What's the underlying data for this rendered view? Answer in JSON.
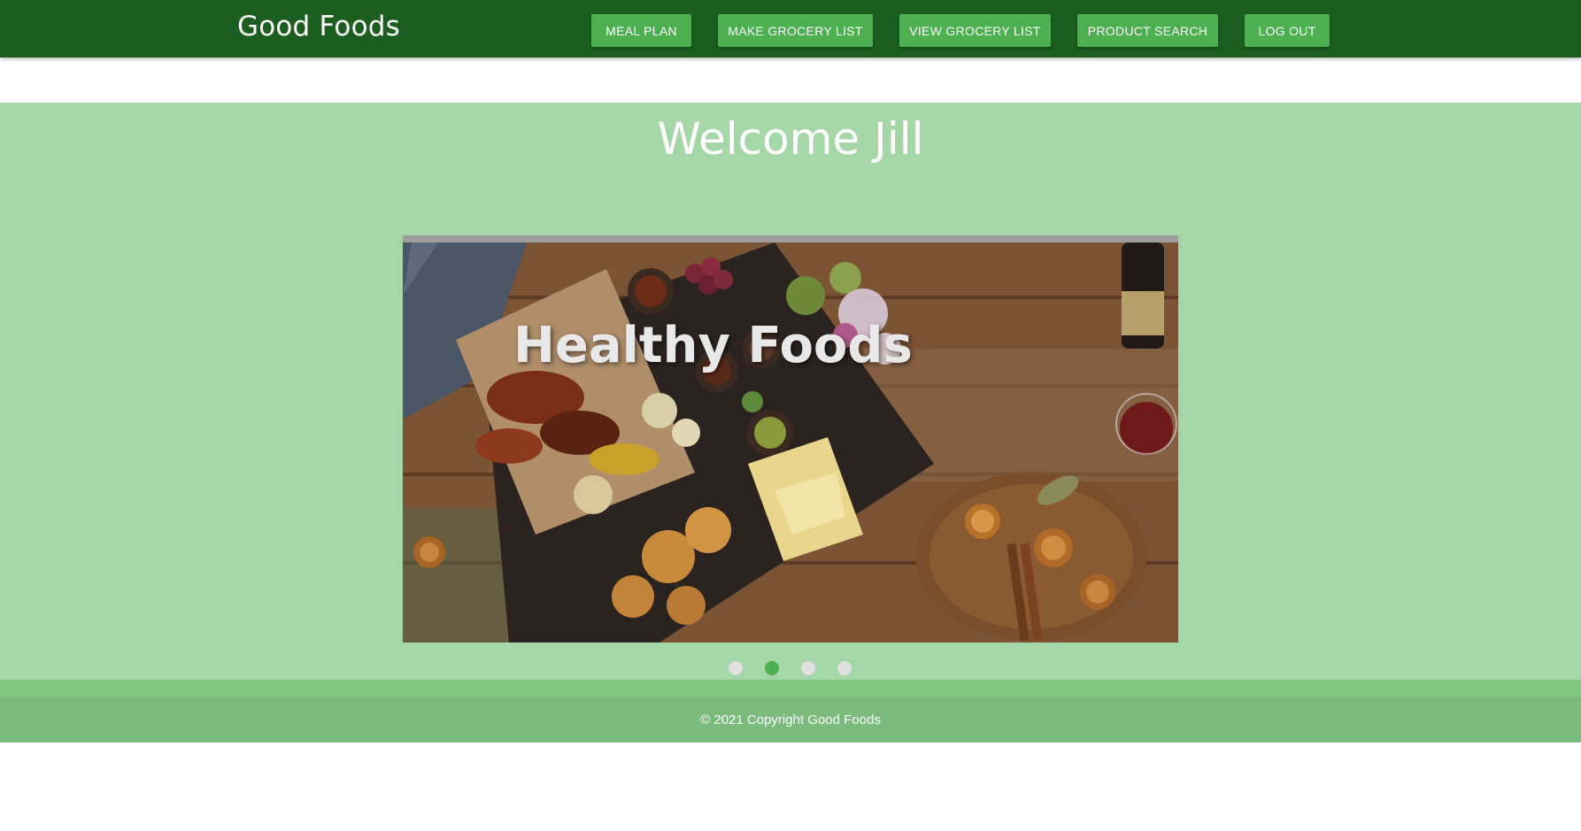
{
  "header": {
    "brand": "Good Foods",
    "nav": {
      "meal_plan": "MEAL PLAN",
      "make_grocery_list": "MAKE GROCERY LIST",
      "view_grocery_list": "VIEW GROCERY LIST",
      "product_search": "PRODUCT SEARCH",
      "log_out": "LOG OUT"
    }
  },
  "main": {
    "welcome": "Welcome Jill",
    "carousel": {
      "caption": "Healthy Foods",
      "slide_count": 4,
      "active_index": 2
    }
  },
  "footer": {
    "copyright": "© 2021 Copyright Good Foods"
  },
  "colors": {
    "header_bg": "#1b5e20",
    "nav_button": "#4caf50",
    "hero_bg": "#a5d6a7",
    "footer_bg": "#7cbb7e",
    "active_dot": "#4caf50"
  }
}
